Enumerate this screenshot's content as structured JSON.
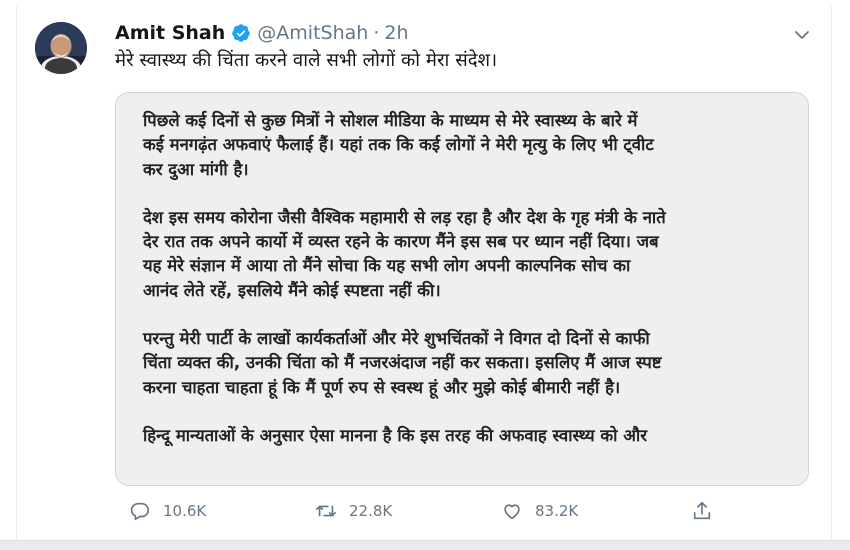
{
  "tweet": {
    "author": {
      "name": "Amit Shah",
      "handle": "@AmitShah",
      "separator": "·",
      "time": "2h",
      "verified": true
    },
    "text": "मेरे स्वास्थ्य की चिंता करने वाले सभी लोगों को मेरा संदेश।",
    "media": {
      "paragraphs": [
        {
          "lines": [
            "पिछले कई दिनों से कुछ मित्रों ने सोशल मीडिया के माध्यम से मेरे स्वास्थ्य के बारे में",
            "कई मनगढ़ंत अफवाएं फैलाई हैं। यहां तक कि कई लोगों ने मेरी मृत्यु के लिए भी ट्वीट",
            "कर दुआ मांगी है।"
          ]
        },
        {
          "lines": [
            "देश इस समय कोरोना जैसी वैश्विक महामारी से लड़ रहा है और देश के गृह मंत्री के नाते",
            "देर रात तक अपने कार्यो में व्यस्त रहने के कारण मैंने इस सब पर ध्यान नहीं दिया। जब",
            "यह मेरे संज्ञान में आया तो मैंने सोचा कि यह सभी लोग अपनी काल्पनिक सोच का",
            "आनंद लेते रहें, इसलिये मैंने कोई स्पष्टता नहीं की।"
          ]
        },
        {
          "lines": [
            "परन्तु मेरी पार्टी के लाखों कार्यकर्ताओं और मेरे शुभचिंतकों ने विगत दो दिनों से काफी",
            "चिंता व्यक्त की, उनकी चिंता को मैं नजरअंदाज नहीं कर सकता। इसलिए मैं आज स्पष्ट",
            "करना चाहता चाहता हूं कि मैं पूर्ण रुप से स्वस्थ हूं और मुझे कोई बीमारी नहीं है।"
          ]
        },
        {
          "lines": [
            "हिन्दू मान्यताओं के अनुसार ऐसा मानना है कि इस तरह की अफवाह स्वास्थ्य को और"
          ]
        }
      ]
    },
    "actions": {
      "reply": {
        "icon": "reply-icon",
        "count": "10.6K"
      },
      "retweet": {
        "icon": "retweet-icon",
        "count": "22.8K"
      },
      "like": {
        "icon": "heart-icon",
        "count": "83.2K"
      },
      "share": {
        "icon": "share-icon",
        "count": ""
      }
    }
  },
  "colors": {
    "verified_badge": "#1da1f2",
    "secondary_text": "#657786",
    "primary_text": "#14171a",
    "border": "#e6ecf0"
  }
}
